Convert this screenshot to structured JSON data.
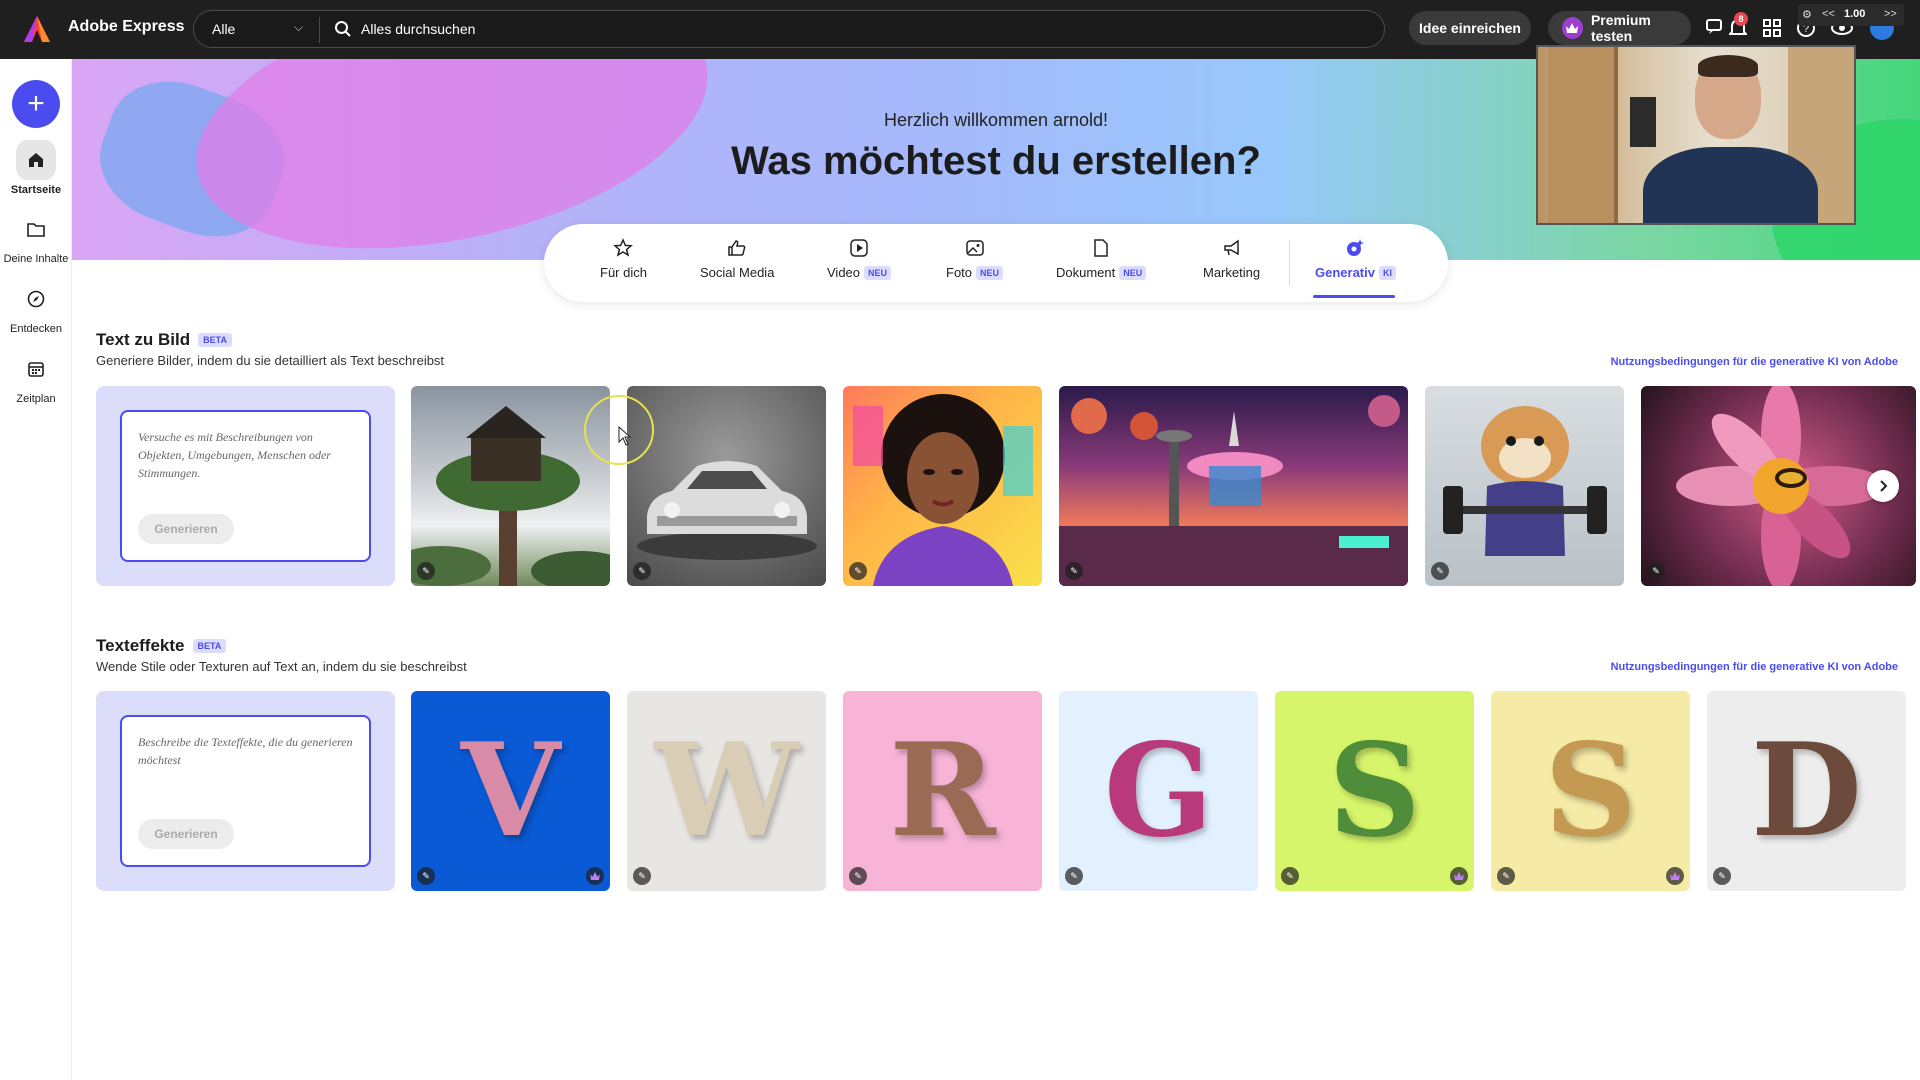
{
  "topbar": {
    "app_title": "Adobe Express",
    "scope": "Alle",
    "search_placeholder": "Alles durchsuchen",
    "idea_button": "Idee einreichen",
    "premium_button": "Premium testen",
    "notification_count": "8",
    "zoom_value": "1.00",
    "zoom_prev": "<<",
    "zoom_next": ">>"
  },
  "sidebar": {
    "create_icon": "plus-icon",
    "items": [
      {
        "label": "Startseite",
        "icon": "home-icon"
      },
      {
        "label": "Deine Inhalte",
        "icon": "folder-icon"
      },
      {
        "label": "Entdecken",
        "icon": "compass-icon"
      },
      {
        "label": "Zeitplan",
        "icon": "calendar-icon"
      }
    ]
  },
  "hero": {
    "greeting": "Herzlich willkommen arnold!",
    "title": "Was möchtest du erstellen?"
  },
  "categories": [
    {
      "label": "Für dich",
      "icon": "star-icon",
      "badge": ""
    },
    {
      "label": "Social Media",
      "icon": "thumbs-up-icon",
      "badge": ""
    },
    {
      "label": "Video",
      "icon": "play-icon",
      "badge": "NEU"
    },
    {
      "label": "Foto",
      "icon": "image-icon",
      "badge": "NEU"
    },
    {
      "label": "Dokument",
      "icon": "document-icon",
      "badge": "NEU"
    },
    {
      "label": "Marketing",
      "icon": "megaphone-icon",
      "badge": ""
    },
    {
      "label": "Generativ",
      "icon": "sparkle-icon",
      "badge": "KI",
      "active": true
    }
  ],
  "text_to_image": {
    "title": "Text zu Bild",
    "badge": "BETA",
    "description": "Generiere Bilder, indem du sie detailliert als Text beschreibst",
    "terms_link": "Nutzungsbedingungen für die generative KI von Adobe",
    "prompt_placeholder": "Versuche es mit Beschreibungen von Objekten, Umgebungen, Menschen oder Stimmungen.",
    "generate_button": "Generieren",
    "tiles": [
      "treehouse-image",
      "vintage-car-image",
      "portrait-image",
      "retro-amusement-park-image",
      "hamster-weightlifting-image",
      "flower-bee-image"
    ]
  },
  "text_effects": {
    "title": "Texteffekte",
    "badge": "BETA",
    "description": "Wende Stile oder Texturen auf Text an, indem du sie beschreibst",
    "terms_link": "Nutzungsbedingungen für die generative KI von Adobe",
    "prompt_placeholder": "Beschreibe die Texteffekte, die du generieren möchtest",
    "generate_button": "Generieren",
    "letters": [
      {
        "char": "V",
        "bg": "#0a5ad6",
        "fg": "#d98aa6",
        "premium": true
      },
      {
        "char": "W",
        "bg": "#e8e6e3",
        "fg": "#d9cdb5",
        "premium": false
      },
      {
        "char": "R",
        "bg": "#f7b4d6",
        "fg": "#9a6a55",
        "premium": false
      },
      {
        "char": "G",
        "bg": "#e3f1ff",
        "fg": "#b83a7a",
        "premium": false
      },
      {
        "char": "S",
        "bg": "#d6f56a",
        "fg": "#4f8d3a",
        "premium": true
      },
      {
        "char": "S",
        "bg": "#f6eba6",
        "fg": "#c49a52",
        "premium": true
      },
      {
        "char": "D",
        "bg": "#ededed",
        "fg": "#6c4a3c",
        "premium": false
      }
    ]
  },
  "colors": {
    "accent": "#4b4cf0",
    "topbar": "#1f1f1f"
  }
}
